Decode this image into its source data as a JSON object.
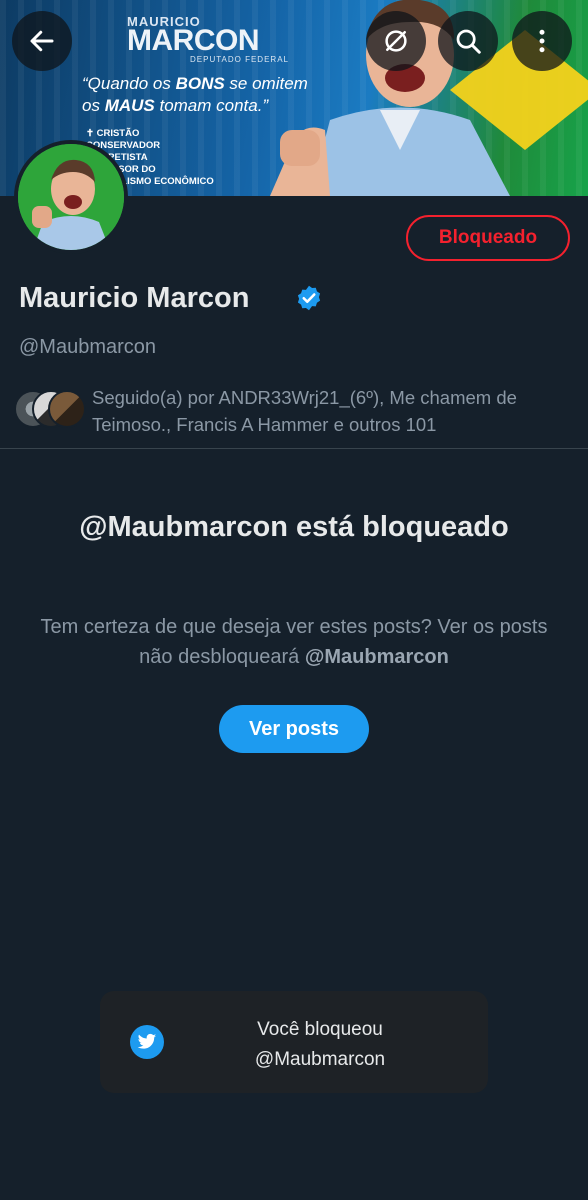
{
  "banner": {
    "first_name": "MAURICIO",
    "last_name": "MARCON",
    "role": "DEPUTADO FEDERAL",
    "quote_line1_pre": "“Quando os ",
    "quote_line1_bold": "BONS",
    "quote_line1_post": " se omitem",
    "quote_line2_pre": "os ",
    "quote_line2_bold": "MAUS",
    "quote_line2_post": " tomam conta.”",
    "values": [
      "✝ CRISTÃO",
      "CONSERVADOR",
      "ANTIPETISTA",
      "DEFENSOR DO",
      "LIBERALISMO ECONÔMICO"
    ]
  },
  "topbar": {
    "back_icon": "arrow-left-icon",
    "sync_icon": "sync-off-icon",
    "search_icon": "search-icon",
    "more_icon": "more-vertical-icon"
  },
  "profile": {
    "name": "Mauricio Marcon",
    "handle": "@Maubmarcon",
    "blocked_label": "Bloqueado",
    "followed_by": "Seguido(a) por ANDR33Wrj21_(6º), Me chamem de Teimoso., Francis A Hammer e outros 101"
  },
  "blocked_notice": {
    "title": "@Maubmarcon está bloqueado",
    "desc_text": "Tem certeza de que deseja ver estes posts? Ver os posts não desbloqueará ",
    "desc_handle": "@Maubmarcon",
    "button_label": "Ver posts"
  },
  "toast": {
    "line1": "Você bloqueou",
    "line2": "@Maubmarcon"
  },
  "colors": {
    "background": "#15202b",
    "accent": "#1d9bf0",
    "danger": "#f4212e",
    "muted": "#8b98a5"
  }
}
